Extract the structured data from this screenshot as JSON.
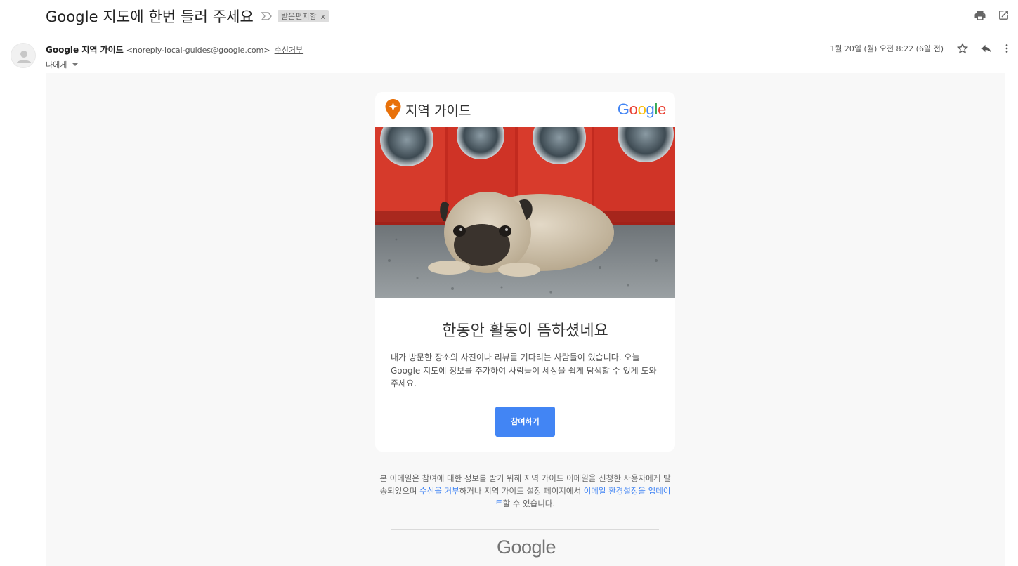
{
  "email": {
    "subject": "Google 지도에 한번 들러 주세요",
    "label_chip": "받은편지함",
    "label_chip_close": "x",
    "sender": {
      "name": "Google 지역 가이드",
      "email": "<noreply-local-guides@google.com>",
      "unsubscribe": "수신거부",
      "to": "나에게"
    },
    "date": "1월 20일 (월) 오전 8:22 (6일 전)"
  },
  "card": {
    "brand": "지역 가이드",
    "google_logo": [
      "G",
      "o",
      "o",
      "g",
      "l",
      "e"
    ],
    "google_logo_colors": [
      "#4285f4",
      "#ea4335",
      "#fbbc05",
      "#4285f4",
      "#34a853",
      "#ea4335"
    ],
    "title": "한동안 활동이 뜸하셨네요",
    "description": "내가 방문한 장소의 사진이나 리뷰를 기다리는 사람들이 있습니다. 오늘 Google 지도에 정보를 추가하여 사람들이 세상을 쉽게 탐색할 수 있게 도와주세요.",
    "cta": "참여하기"
  },
  "footer": {
    "text_1": "본 이메일은 참여에 대한 정보를 받기 위해 지역 가이드 이메일을 신청한 사용자에게 발송되었으며 ",
    "link_1": "수신을 거부",
    "text_2": "하거나 지역 가이드 설정 페이지에서 ",
    "link_2": "이메일 환경설정을 업데이트",
    "text_3": "할 수 있습니다.",
    "logo": "Google"
  },
  "icons": {
    "print": "print-icon",
    "open_new": "open-in-new-window-icon",
    "star": "star-icon",
    "reply": "reply-icon",
    "more": "more-vertical-icon",
    "importance": "importance-marker-icon",
    "pin": "local-guides-pin-icon"
  }
}
